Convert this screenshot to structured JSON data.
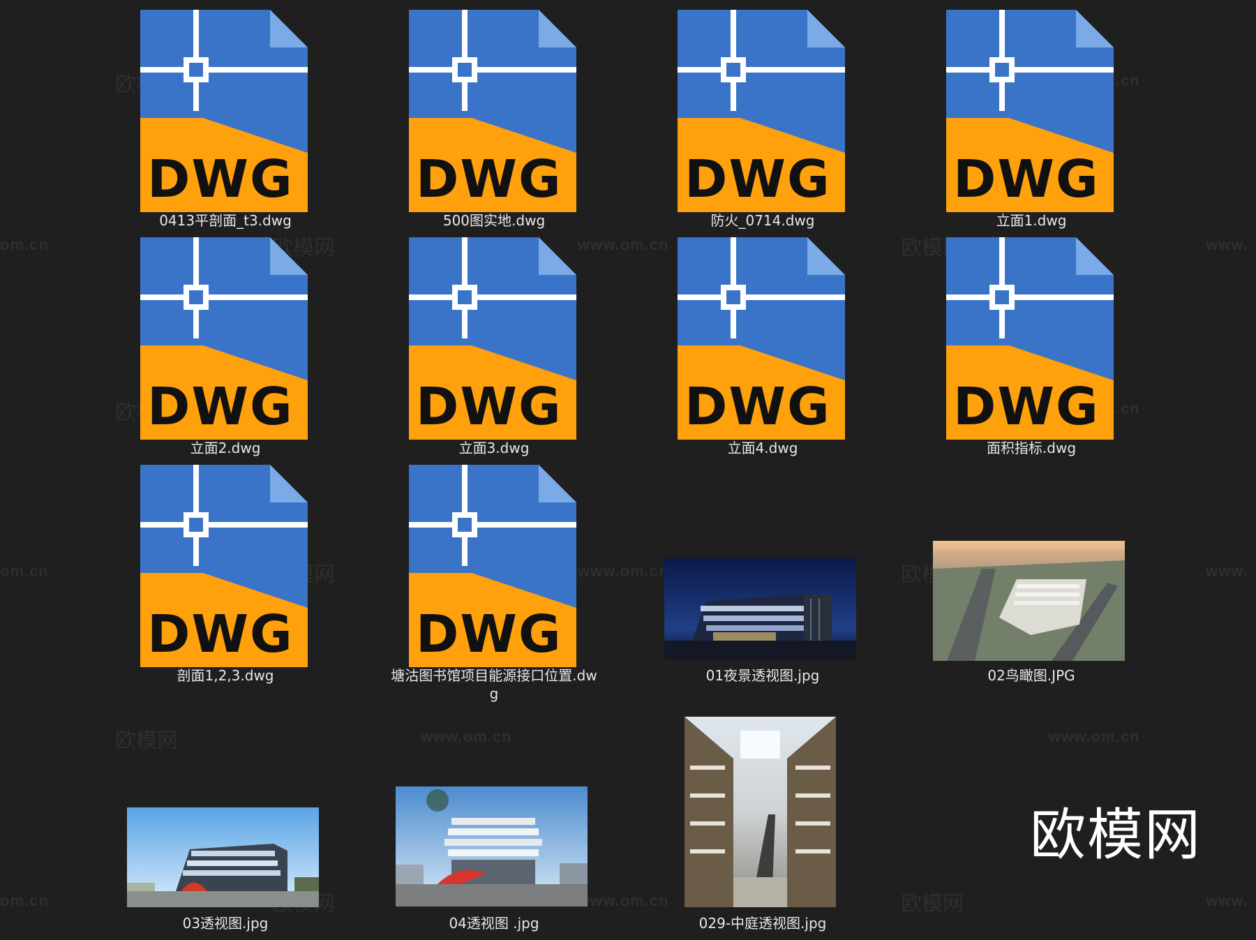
{
  "brand": {
    "name": "欧模网"
  },
  "watermarks": {
    "brand_text": "欧模网",
    "url_text": "www.om.cn",
    "url_partial_left": "om.cn",
    "url_partial_right": "www."
  },
  "dwg_icon": {
    "badge_text": "DWG",
    "colors": {
      "blue": "#3a74c8",
      "fold": "#7aaae8",
      "orange": "#ffa10c",
      "grid": "#ffffff",
      "text": "#111111"
    }
  },
  "files": [
    {
      "name": "0413平剖面_t3.dwg",
      "type": "dwg"
    },
    {
      "name": "500图实地.dwg",
      "type": "dwg"
    },
    {
      "name": "防火_0714.dwg",
      "type": "dwg"
    },
    {
      "name": "立面1.dwg",
      "type": "dwg"
    },
    {
      "name": "立面2.dwg",
      "type": "dwg"
    },
    {
      "name": "立面3.dwg",
      "type": "dwg"
    },
    {
      "name": "立面4.dwg",
      "type": "dwg"
    },
    {
      "name": "面积指标.dwg",
      "type": "dwg"
    },
    {
      "name": "剖面1,2,3.dwg",
      "type": "dwg"
    },
    {
      "name": "塘沽图书馆项目能源接口位置.dwg",
      "type": "dwg"
    },
    {
      "name": "01夜景透视图.jpg",
      "type": "image",
      "icon": "night-building-thumbnail"
    },
    {
      "name": "02鸟瞰图.JPG",
      "type": "image",
      "icon": "aerial-view-thumbnail"
    },
    {
      "name": "03透视图.jpg",
      "type": "image",
      "icon": "day-perspective-thumbnail"
    },
    {
      "name": "04透视图 .jpg",
      "type": "image",
      "icon": "front-perspective-thumbnail"
    },
    {
      "name": "029-中庭透视图.jpg",
      "type": "image",
      "icon": "atrium-interior-thumbnail"
    }
  ]
}
